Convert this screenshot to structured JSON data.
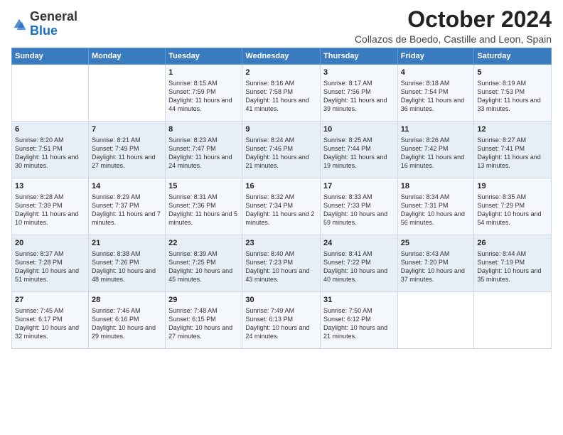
{
  "logo": {
    "general": "General",
    "blue": "Blue"
  },
  "header": {
    "month": "October 2024",
    "location": "Collazos de Boedo, Castille and Leon, Spain"
  },
  "weekdays": [
    "Sunday",
    "Monday",
    "Tuesday",
    "Wednesday",
    "Thursday",
    "Friday",
    "Saturday"
  ],
  "weeks": [
    [
      {
        "day": "",
        "sunrise": "",
        "sunset": "",
        "daylight": ""
      },
      {
        "day": "",
        "sunrise": "",
        "sunset": "",
        "daylight": ""
      },
      {
        "day": "1",
        "sunrise": "Sunrise: 8:15 AM",
        "sunset": "Sunset: 7:59 PM",
        "daylight": "Daylight: 11 hours and 44 minutes."
      },
      {
        "day": "2",
        "sunrise": "Sunrise: 8:16 AM",
        "sunset": "Sunset: 7:58 PM",
        "daylight": "Daylight: 11 hours and 41 minutes."
      },
      {
        "day": "3",
        "sunrise": "Sunrise: 8:17 AM",
        "sunset": "Sunset: 7:56 PM",
        "daylight": "Daylight: 11 hours and 39 minutes."
      },
      {
        "day": "4",
        "sunrise": "Sunrise: 8:18 AM",
        "sunset": "Sunset: 7:54 PM",
        "daylight": "Daylight: 11 hours and 36 minutes."
      },
      {
        "day": "5",
        "sunrise": "Sunrise: 8:19 AM",
        "sunset": "Sunset: 7:53 PM",
        "daylight": "Daylight: 11 hours and 33 minutes."
      }
    ],
    [
      {
        "day": "6",
        "sunrise": "Sunrise: 8:20 AM",
        "sunset": "Sunset: 7:51 PM",
        "daylight": "Daylight: 11 hours and 30 minutes."
      },
      {
        "day": "7",
        "sunrise": "Sunrise: 8:21 AM",
        "sunset": "Sunset: 7:49 PM",
        "daylight": "Daylight: 11 hours and 27 minutes."
      },
      {
        "day": "8",
        "sunrise": "Sunrise: 8:23 AM",
        "sunset": "Sunset: 7:47 PM",
        "daylight": "Daylight: 11 hours and 24 minutes."
      },
      {
        "day": "9",
        "sunrise": "Sunrise: 8:24 AM",
        "sunset": "Sunset: 7:46 PM",
        "daylight": "Daylight: 11 hours and 21 minutes."
      },
      {
        "day": "10",
        "sunrise": "Sunrise: 8:25 AM",
        "sunset": "Sunset: 7:44 PM",
        "daylight": "Daylight: 11 hours and 19 minutes."
      },
      {
        "day": "11",
        "sunrise": "Sunrise: 8:26 AM",
        "sunset": "Sunset: 7:42 PM",
        "daylight": "Daylight: 11 hours and 16 minutes."
      },
      {
        "day": "12",
        "sunrise": "Sunrise: 8:27 AM",
        "sunset": "Sunset: 7:41 PM",
        "daylight": "Daylight: 11 hours and 13 minutes."
      }
    ],
    [
      {
        "day": "13",
        "sunrise": "Sunrise: 8:28 AM",
        "sunset": "Sunset: 7:39 PM",
        "daylight": "Daylight: 11 hours and 10 minutes."
      },
      {
        "day": "14",
        "sunrise": "Sunrise: 8:29 AM",
        "sunset": "Sunset: 7:37 PM",
        "daylight": "Daylight: 11 hours and 7 minutes."
      },
      {
        "day": "15",
        "sunrise": "Sunrise: 8:31 AM",
        "sunset": "Sunset: 7:36 PM",
        "daylight": "Daylight: 11 hours and 5 minutes."
      },
      {
        "day": "16",
        "sunrise": "Sunrise: 8:32 AM",
        "sunset": "Sunset: 7:34 PM",
        "daylight": "Daylight: 11 hours and 2 minutes."
      },
      {
        "day": "17",
        "sunrise": "Sunrise: 8:33 AM",
        "sunset": "Sunset: 7:33 PM",
        "daylight": "Daylight: 10 hours and 59 minutes."
      },
      {
        "day": "18",
        "sunrise": "Sunrise: 8:34 AM",
        "sunset": "Sunset: 7:31 PM",
        "daylight": "Daylight: 10 hours and 56 minutes."
      },
      {
        "day": "19",
        "sunrise": "Sunrise: 8:35 AM",
        "sunset": "Sunset: 7:29 PM",
        "daylight": "Daylight: 10 hours and 54 minutes."
      }
    ],
    [
      {
        "day": "20",
        "sunrise": "Sunrise: 8:37 AM",
        "sunset": "Sunset: 7:28 PM",
        "daylight": "Daylight: 10 hours and 51 minutes."
      },
      {
        "day": "21",
        "sunrise": "Sunrise: 8:38 AM",
        "sunset": "Sunset: 7:26 PM",
        "daylight": "Daylight: 10 hours and 48 minutes."
      },
      {
        "day": "22",
        "sunrise": "Sunrise: 8:39 AM",
        "sunset": "Sunset: 7:25 PM",
        "daylight": "Daylight: 10 hours and 45 minutes."
      },
      {
        "day": "23",
        "sunrise": "Sunrise: 8:40 AM",
        "sunset": "Sunset: 7:23 PM",
        "daylight": "Daylight: 10 hours and 43 minutes."
      },
      {
        "day": "24",
        "sunrise": "Sunrise: 8:41 AM",
        "sunset": "Sunset: 7:22 PM",
        "daylight": "Daylight: 10 hours and 40 minutes."
      },
      {
        "day": "25",
        "sunrise": "Sunrise: 8:43 AM",
        "sunset": "Sunset: 7:20 PM",
        "daylight": "Daylight: 10 hours and 37 minutes."
      },
      {
        "day": "26",
        "sunrise": "Sunrise: 8:44 AM",
        "sunset": "Sunset: 7:19 PM",
        "daylight": "Daylight: 10 hours and 35 minutes."
      }
    ],
    [
      {
        "day": "27",
        "sunrise": "Sunrise: 7:45 AM",
        "sunset": "Sunset: 6:17 PM",
        "daylight": "Daylight: 10 hours and 32 minutes."
      },
      {
        "day": "28",
        "sunrise": "Sunrise: 7:46 AM",
        "sunset": "Sunset: 6:16 PM",
        "daylight": "Daylight: 10 hours and 29 minutes."
      },
      {
        "day": "29",
        "sunrise": "Sunrise: 7:48 AM",
        "sunset": "Sunset: 6:15 PM",
        "daylight": "Daylight: 10 hours and 27 minutes."
      },
      {
        "day": "30",
        "sunrise": "Sunrise: 7:49 AM",
        "sunset": "Sunset: 6:13 PM",
        "daylight": "Daylight: 10 hours and 24 minutes."
      },
      {
        "day": "31",
        "sunrise": "Sunrise: 7:50 AM",
        "sunset": "Sunset: 6:12 PM",
        "daylight": "Daylight: 10 hours and 21 minutes."
      },
      {
        "day": "",
        "sunrise": "",
        "sunset": "",
        "daylight": ""
      },
      {
        "day": "",
        "sunrise": "",
        "sunset": "",
        "daylight": ""
      }
    ]
  ]
}
